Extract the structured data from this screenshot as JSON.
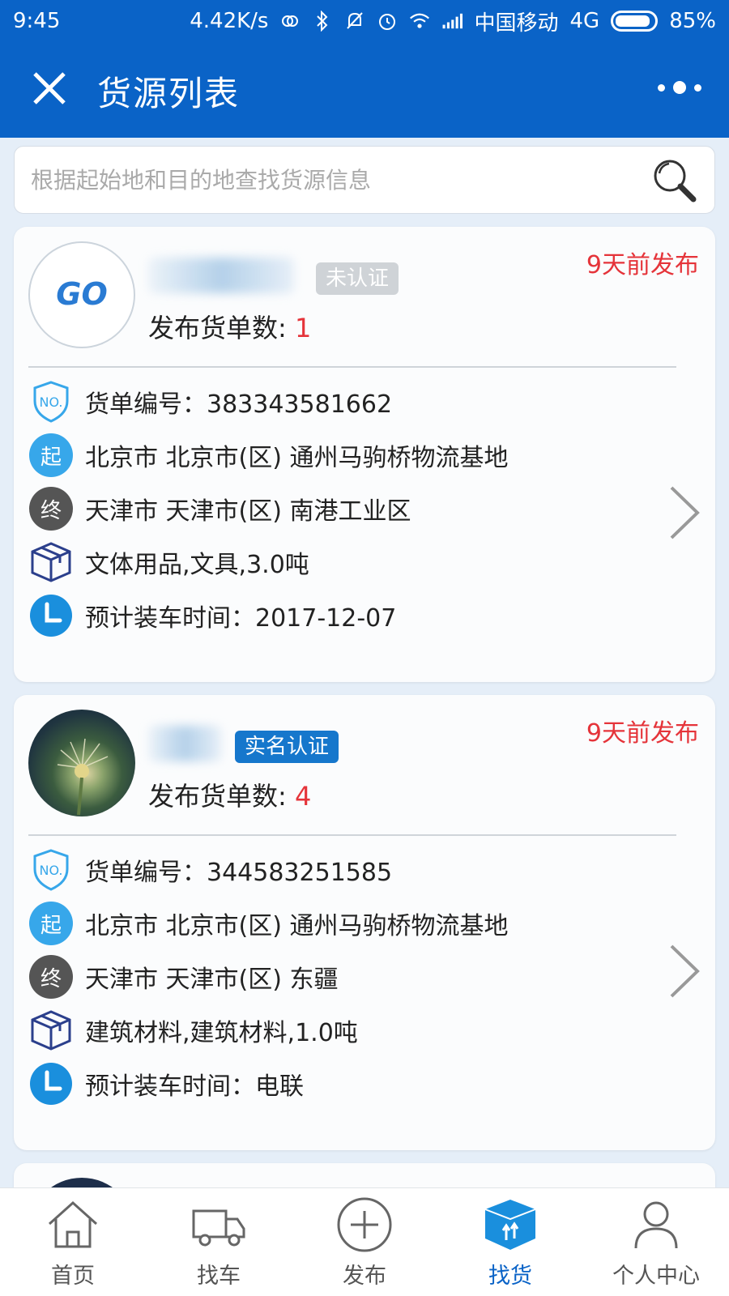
{
  "status_bar": {
    "time": "9:45",
    "speed": "4.42K/s",
    "carrier": "中国移动",
    "network": "4G",
    "battery": "85%"
  },
  "header": {
    "title": "货源列表"
  },
  "search": {
    "placeholder": "根据起始地和目的地查找货源信息"
  },
  "cards": [
    {
      "badge": "未认证",
      "posted": "9天前发布",
      "count_label": "发布货单数: ",
      "count": "1",
      "order_no": "货单编号：383343581662",
      "start": "北京市 北京市(区) 通州马驹桥物流基地",
      "end": "天津市 天津市(区) 南港工业区",
      "goods": "文体用品,文具,3.0吨",
      "load_time": "预计装车时间：2017-12-07",
      "start_icon": "起",
      "end_icon": "终"
    },
    {
      "badge": "实名认证",
      "posted": "9天前发布",
      "count_label": "发布货单数: ",
      "count": "4",
      "order_no": "货单编号：344583251585",
      "start": "北京市 北京市(区) 通州马驹桥物流基地",
      "end": "天津市 天津市(区) 东疆",
      "goods": "建筑材料,建筑材料,1.0吨",
      "load_time": "预计装车时间：电联",
      "start_icon": "起",
      "end_icon": "终"
    }
  ],
  "tabs": [
    {
      "label": "首页",
      "icon": "home-icon"
    },
    {
      "label": "找车",
      "icon": "truck-icon"
    },
    {
      "label": "发布",
      "icon": "plus-circle-icon"
    },
    {
      "label": "找货",
      "icon": "cargo-box-icon"
    },
    {
      "label": "个人中心",
      "icon": "person-icon"
    }
  ],
  "colors": {
    "primary": "#0a63c7",
    "accent_red": "#e5343a",
    "start_blue": "#37a7ea",
    "end_gray": "#555555",
    "background": "#e5eef8"
  }
}
